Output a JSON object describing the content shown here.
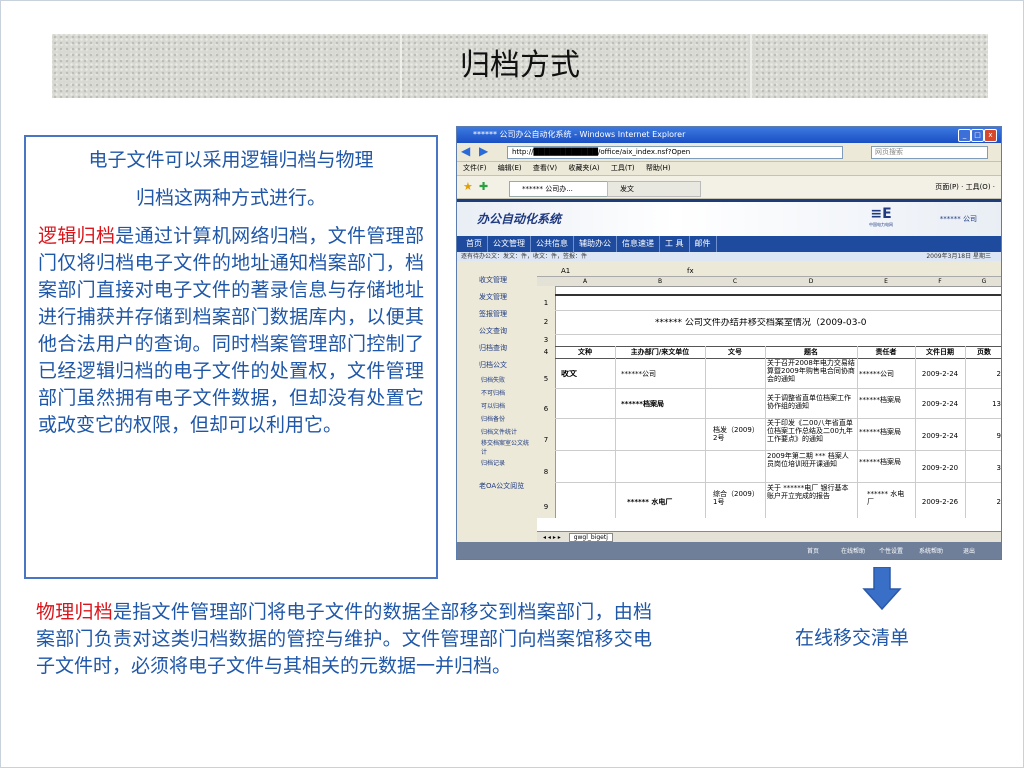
{
  "slide": {
    "title": "归档方式",
    "intro_line1": "电子文件可以采用逻辑归档与物理",
    "intro_line2": "归档这两种方式进行。",
    "logical_term": "逻辑归档",
    "logical_text": "是通过计算机网络归档，文件管理部门仅将归档电子文件的地址通知档案部门，档案部门直接对电子文件的著录信息与存储地址进行捕获并存储到档案部门数据库内，以便其他合法用户的查询。同时档案管理部门控制了已经逻辑归档的电子文件的处置权，文件管理部门虽然拥有电子文件数据，但却没有处置它或改变它的权限，但却可以利用它。",
    "physical_term": "物理归档",
    "physical_text": "是指文件管理部门将电子文件的数据全部移交到档案部门，由档案部门负责对这类归档数据的管控与维护。文件管理部门向档案馆移交电子文件时，必须将电子文件与其相关的元数据一并归档。",
    "caption": "在线移交清单",
    "colors": {
      "accent_blue": "#1f57a8",
      "term_red": "#d8151b",
      "box_border": "#4a74c4",
      "arrow": "#3a6fc8"
    }
  },
  "screenshot": {
    "window_title": "****** 公司办公自动化系统 - Windows Internet Explorer",
    "address": "http://████████████/office/aix_index.nsf?Open",
    "search_placeholder": "网页搜索",
    "menu": [
      "文件(F)",
      "编辑(E)",
      "查看(V)",
      "收藏夹(A)",
      "工具(T)",
      "帮助(H)"
    ],
    "tab1": "****** 公司办...",
    "tab2": "发文",
    "toolbar_right": "页面(P) · 工具(O) ·",
    "oa_name": "办公自动化系统",
    "company": "****** 公司",
    "logo_text": "中国电力电网",
    "nav": [
      "首页",
      "公文管理",
      "公共信息",
      "辅助办公",
      "信息速递",
      "工 具",
      "邮件"
    ],
    "info_left": "逐有待办公文：发文：件，收文：件，签报：件",
    "info_right": "2009年3月18日  星期三",
    "side_menu": [
      "收文管理",
      "发文管理",
      "签报管理",
      "公文查询",
      "归档查询",
      "归档公文"
    ],
    "side_sub": [
      "归档失败",
      "不可归档",
      "可以归档",
      "归档备份",
      "归档文件统计",
      "移交档案室公文统计",
      "归档记录"
    ],
    "side_bottom": "老OA公文阅览",
    "cell_ref": "A1",
    "sheet_title": "******    公司文件办结并移交档案室情况（2009-03-0",
    "col_letters": [
      "A",
      "B",
      "C",
      "D",
      "E",
      "F",
      "G"
    ],
    "headers": [
      "文种",
      "主办部门/来文单位",
      "文号",
      "题名",
      "责任者",
      "文件日期",
      "页数"
    ],
    "rows": [
      {
        "n": "5",
        "type": "收文",
        "dept": "******公司",
        "no": "",
        "title": "关于召开2008年电力交易结算暨2009年购售电合同协商会的通知",
        "owner": "******公司",
        "date": "2009-2-24",
        "pages": "2"
      },
      {
        "n": "6",
        "type": "",
        "dept": "******档案局",
        "no": "",
        "title": "关于调整省直单位档案工作协作组的通知",
        "owner": "******档案局",
        "date": "2009-2-24",
        "pages": "13"
      },
      {
        "n": "7",
        "type": "",
        "dept": "",
        "no": "档发（2009）2号",
        "title": "关于印发《二00八年省直单位档案工作总结及二00九年工作要点》的通知",
        "owner": "******档案局",
        "date": "2009-2-24",
        "pages": "9"
      },
      {
        "n": "8",
        "type": "",
        "dept": "",
        "no": "",
        "title": "2009年第二期 *** 档案人员岗位培训班开课通知",
        "owner": "******档案局",
        "date": "2009-2-20",
        "pages": "3"
      },
      {
        "n": "9",
        "type": "",
        "dept": "****** 水电厂",
        "no": "综合（2009）1号",
        "title": "关于 ******电厂 银行基本账户开立完成的报告",
        "owner": "****** 水电厂",
        "date": "2009-2-26",
        "pages": "2"
      }
    ],
    "sheet_tab": "gwgl_bigetj",
    "status_items": [
      "首页",
      "在线帮助",
      "个性设置",
      "系统帮助",
      "退出"
    ]
  }
}
